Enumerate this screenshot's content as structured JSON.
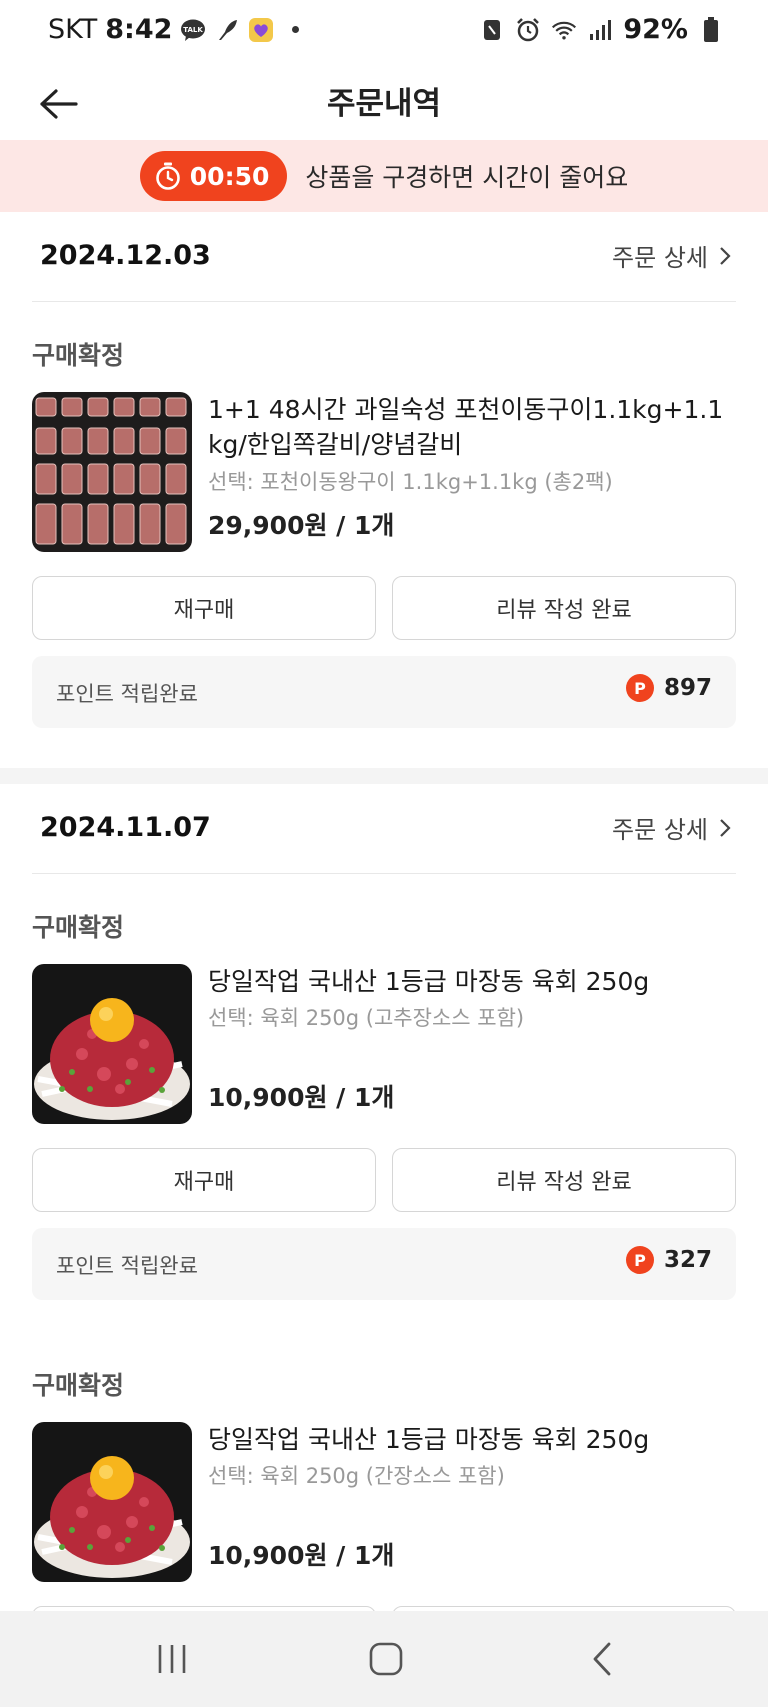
{
  "status_bar": {
    "carrier": "SKT",
    "time": "8:42",
    "battery": "92%",
    "icons": [
      "talk-icon",
      "feather-icon",
      "heart-app-icon",
      "dot-icon",
      "nfc-icon",
      "alarm-icon",
      "wifi-icon",
      "signal-icon",
      "battery-icon"
    ]
  },
  "header": {
    "title": "주문내역",
    "back_icon": "back-arrow-icon"
  },
  "banner": {
    "timer": "00:50",
    "text": "상품을 구경하면 시간이 줄어요",
    "color": "#f0431e",
    "background": "#fde7e5"
  },
  "orders": [
    {
      "date": "2024.12.03",
      "detail_label": "주문 상세",
      "items": [
        {
          "status": "구매확정",
          "name": "1+1 48시간 과일숙성 포천이동구이1.1kg+1.1kg/한입쪽갈비/양념갈비",
          "option": "선택: 포천이동왕구이 1.1kg+1.1kg (총2팩)",
          "price": "29,900원 / 1개",
          "rebuy_label": "재구매",
          "review_label": "리뷰 작성 완료",
          "points_label": "포인트 적립완료",
          "points_value": "897"
        }
      ]
    },
    {
      "date": "2024.11.07",
      "detail_label": "주문 상세",
      "items": [
        {
          "status": "구매확정",
          "name": "당일작업 국내산 1등급 마장동 육회 250g",
          "option": "선택: 육회 250g (고추장소스 포함)",
          "price": "10,900원 / 1개",
          "rebuy_label": "재구매",
          "review_label": "리뷰 작성 완료",
          "points_label": "포인트 적립완료",
          "points_value": "327"
        },
        {
          "status": "구매확정",
          "name": "당일작업 국내산 1등급 마장동 육회 250g",
          "option": "선택: 육회 250g (간장소스 포함)",
          "price": "10,900원 / 1개"
        }
      ]
    }
  ],
  "point_badge": "P",
  "navbar": {
    "icons": [
      "recent-apps-icon",
      "home-icon",
      "back-icon"
    ]
  }
}
